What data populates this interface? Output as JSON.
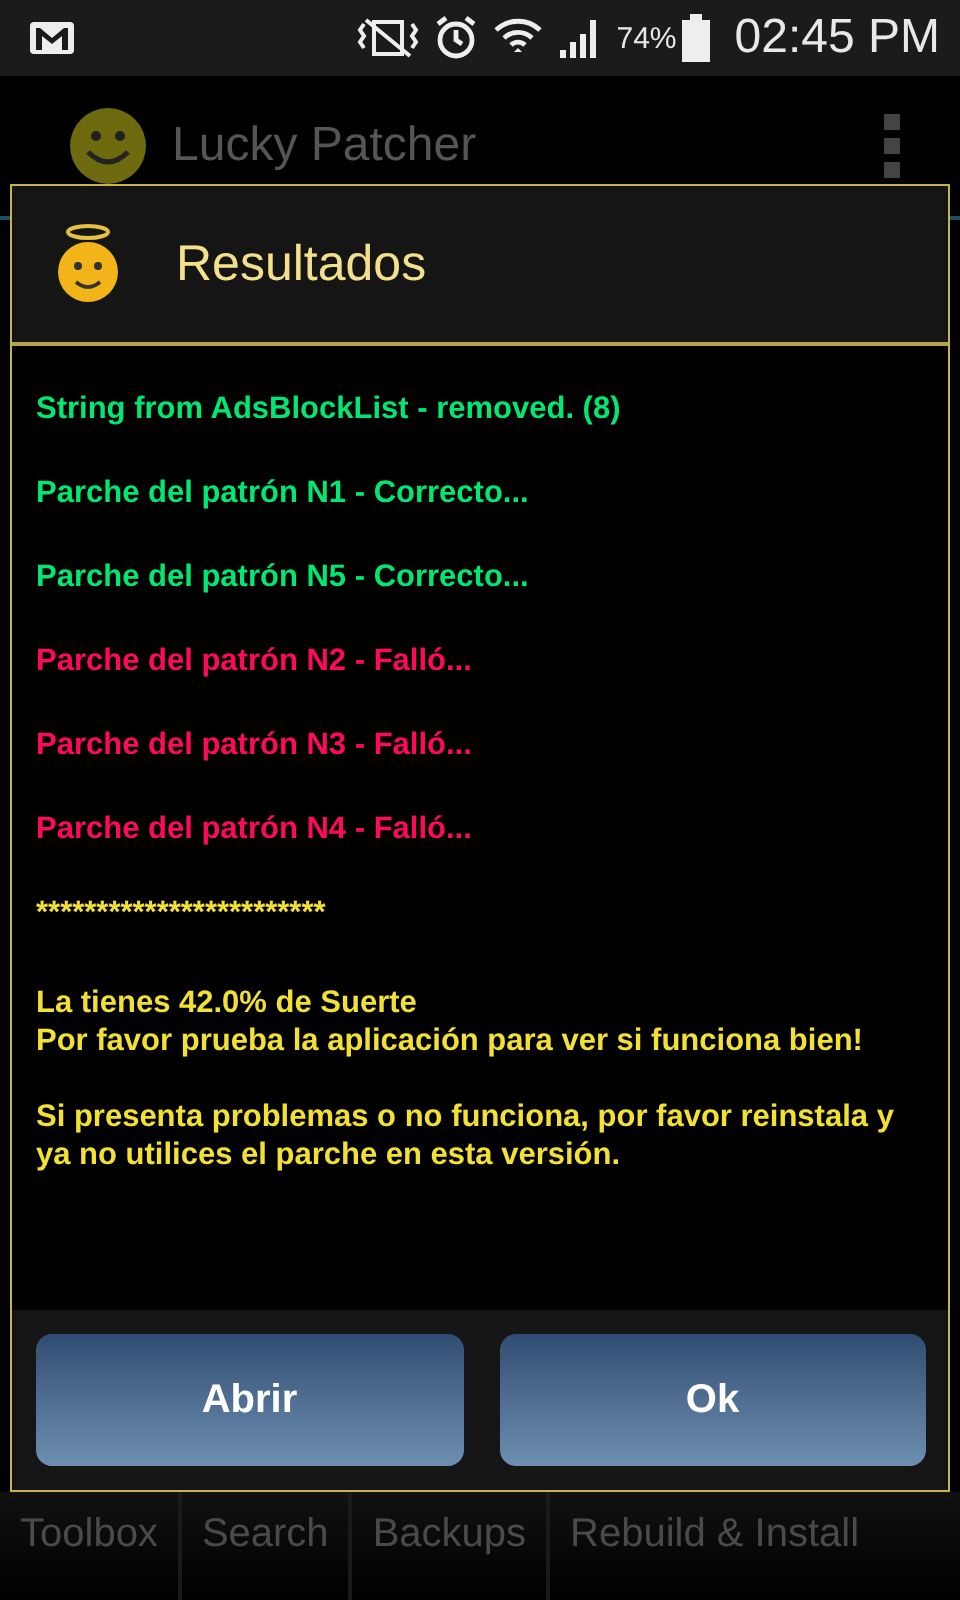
{
  "status_bar": {
    "battery_text": "74%",
    "time": "02:45 PM"
  },
  "app_bar": {
    "title": "Lucky Patcher"
  },
  "dialog": {
    "title": "Resultados",
    "messages": [
      {
        "kind": "success",
        "text": "String from AdsBlockList - removed. (8)"
      },
      {
        "kind": "success",
        "text": "Parche del patrón N1 - Correcto..."
      },
      {
        "kind": "success",
        "text": "Parche del patrón N5 - Correcto..."
      },
      {
        "kind": "failure",
        "text": "Parche del patrón N2 - Falló..."
      },
      {
        "kind": "failure",
        "text": "Parche del patrón N3 - Falló..."
      },
      {
        "kind": "failure",
        "text": "Parche del patrón N4 - Falló..."
      }
    ],
    "separator": "************************",
    "summary": [
      {
        "lines": [
          "La tienes 42.0% de Suerte",
          "Por favor prueba la aplicación para ver si funciona bien!"
        ]
      },
      {
        "lines": [
          "Si presenta problemas o no funciona, por favor reinstala y ya no utilices el parche en esta versión."
        ]
      }
    ],
    "buttons": [
      "Abrir",
      "Ok"
    ]
  },
  "tabs": [
    {
      "label": "Toolbox"
    },
    {
      "label": "Search"
    },
    {
      "label": "Backups"
    },
    {
      "label": "Rebuild & Install"
    }
  ]
}
